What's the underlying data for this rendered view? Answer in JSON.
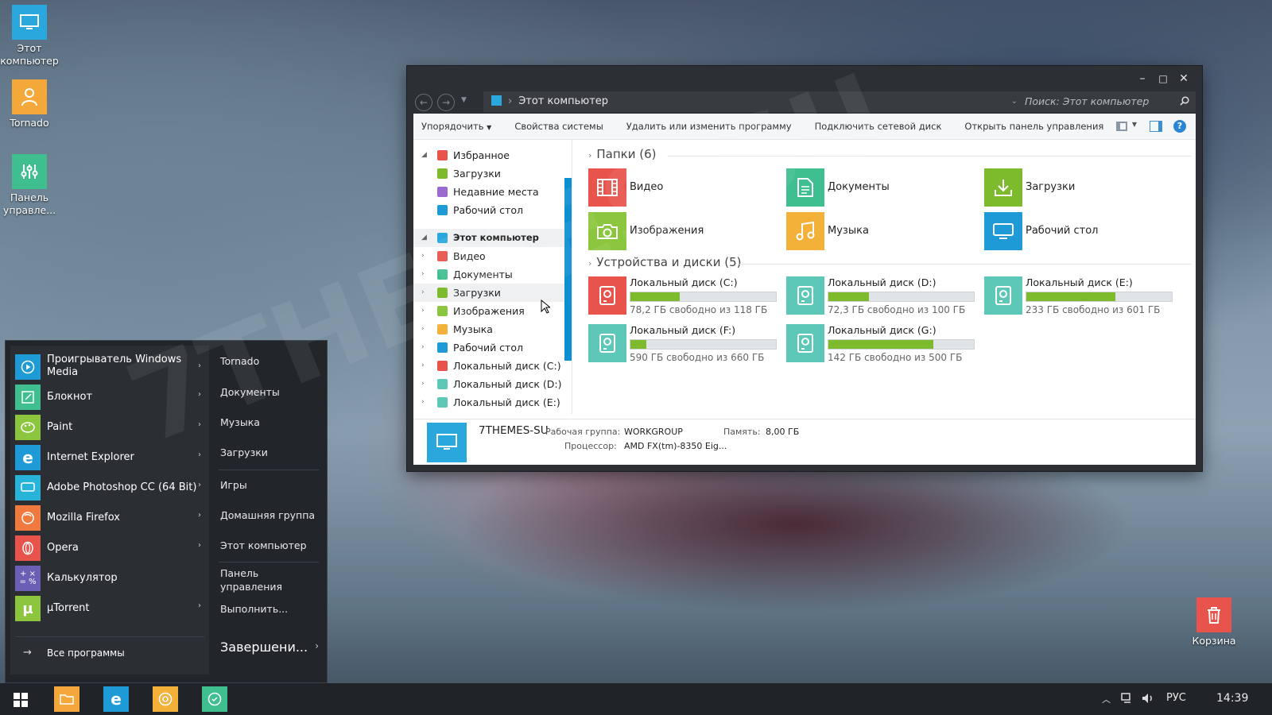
{
  "desktop": {
    "icons": [
      {
        "label": "Этот компьютер",
        "icon": "monitor-icon",
        "color": "#2aa7dc"
      },
      {
        "label": "Tornado",
        "icon": "user-icon",
        "color": "#f4a83a"
      },
      {
        "label": "Панель управле...",
        "icon": "sliders-icon",
        "color": "#3fbf8f"
      }
    ],
    "recycle_bin": {
      "label": "Корзина",
      "icon": "trash-icon",
      "color": "#e8534c"
    },
    "watermark": "7THEMES.SU"
  },
  "explorer": {
    "controls": {
      "minimize": "–",
      "maximize": "□",
      "close": "✕"
    },
    "address": {
      "path": "Этот компьютер"
    },
    "search": {
      "placeholder": "Поиск: Этот компьютер"
    },
    "toolbar": [
      "Упорядочить",
      "Свойства системы",
      "Удалить или изменить программу",
      "Подключить сетевой диск",
      "Открыть панель управления"
    ],
    "tree": {
      "favorites": {
        "label": "Избранное",
        "items": [
          "Загрузки",
          "Недавние места",
          "Рабочий стол"
        ]
      },
      "computer": {
        "label": "Этот компьютер",
        "items": [
          "Видео",
          "Документы",
          "Загрузки",
          "Изображения",
          "Музыка",
          "Рабочий стол",
          "Локальный диск (C:)",
          "Локальный диск (D:)",
          "Локальный диск (E:)"
        ]
      }
    },
    "folders_title": "Папки (6)",
    "folders": [
      {
        "name": "Видео",
        "color": "#e8534c",
        "icon": "film-icon"
      },
      {
        "name": "Документы",
        "color": "#3fbf8f",
        "icon": "document-icon"
      },
      {
        "name": "Загрузки",
        "color": "#7dbb2c",
        "icon": "download-icon"
      },
      {
        "name": "Изображения",
        "color": "#8cc63f",
        "icon": "camera-icon"
      },
      {
        "name": "Музыка",
        "color": "#f4b13a",
        "icon": "music-icon"
      },
      {
        "name": "Рабочий стол",
        "color": "#1e9bd7",
        "icon": "desktop-icon"
      }
    ],
    "drives_title": "Устройства и диски (5)",
    "drives": [
      {
        "name": "Локальный диск (C:)",
        "free": "78,2 ГБ свободно из 118 ГБ",
        "used_fraction": 0.34,
        "color": "#e8534c"
      },
      {
        "name": "Локальный диск (D:)",
        "free": "72,3 ГБ свободно из 100 ГБ",
        "used_fraction": 0.28,
        "color": "#5ec8b8"
      },
      {
        "name": "Локальный диск (E:)",
        "free": "233 ГБ свободно из 601 ГБ",
        "used_fraction": 0.61,
        "color": "#5ec8b8"
      },
      {
        "name": "Локальный диск (F:)",
        "free": "590 ГБ свободно из 660 ГБ",
        "used_fraction": 0.11,
        "color": "#5ec8b8"
      },
      {
        "name": "Локальный диск (G:)",
        "free": "142 ГБ свободно из 500 ГБ",
        "used_fraction": 0.72,
        "color": "#5ec8b8"
      }
    ],
    "details": {
      "computer_name": "7THEMES-SU",
      "workgroup_label": "Рабочая группа:",
      "workgroup": "WORKGROUP",
      "memory_label": "Память:",
      "memory": "8,00 ГБ",
      "cpu_label": "Процессор:",
      "cpu": "AMD FX(tm)-8350 Eig..."
    }
  },
  "start_menu": {
    "apps": [
      {
        "name": "Проигрыватель Windows Media",
        "color": "#1e9bd7",
        "arrow": true
      },
      {
        "name": "Блокнот",
        "color": "#3fbf8f",
        "arrow": true
      },
      {
        "name": "Paint",
        "color": "#8cc63f",
        "arrow": true
      },
      {
        "name": "Internet Explorer",
        "color": "#1e9bd7",
        "arrow": true
      },
      {
        "name": "Adobe Photoshop CC (64 Bit)",
        "color": "#28b4d8",
        "arrow": true
      },
      {
        "name": "Mozilla Firefox",
        "color": "#f07a3e",
        "arrow": true
      },
      {
        "name": "Opera",
        "color": "#e8534c",
        "arrow": true
      },
      {
        "name": "Калькулятор",
        "color": "#6a5fb5",
        "arrow": false
      },
      {
        "name": "µTorrent",
        "color": "#8cc63f",
        "arrow": true
      }
    ],
    "all_programs": "Все программы",
    "places": [
      "Tornado",
      "Документы",
      "Музыка",
      "Загрузки",
      "Игры",
      "Домашняя группа",
      "Этот компьютер",
      "Панель управления",
      "Выполнить..."
    ],
    "shutdown": "Завершени..."
  },
  "taskbar": {
    "pinned": [
      {
        "icon": "folder-icon",
        "color": "#f4a83a"
      },
      {
        "icon": "ie-icon",
        "color": "#1e9bd7"
      },
      {
        "icon": "chrome-icon",
        "color": "#f4b13a"
      },
      {
        "icon": "app-icon",
        "color": "#3fbf8f"
      }
    ],
    "language": "РУС",
    "time": "14:39"
  }
}
